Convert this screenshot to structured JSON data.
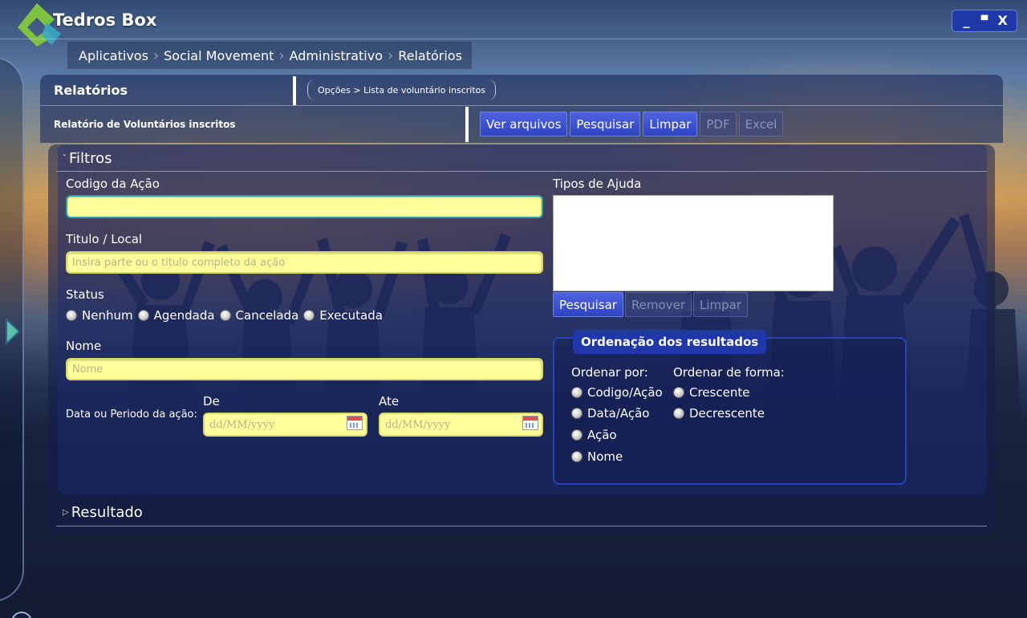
{
  "app": {
    "title": "Tedros Box"
  },
  "window_controls": {
    "minimize": "_",
    "maximize": "▀",
    "close": "X"
  },
  "breadcrumb": [
    "Aplicativos",
    "Social Movement",
    "Administrativo",
    "Relatórios"
  ],
  "header": {
    "title": "Relatórios",
    "path": "Opções > Lista de voluntário inscritos",
    "subtitle": "Relatório de Voluntários inscritos"
  },
  "toolbar": {
    "buttons": [
      {
        "label": "Ver arquivos",
        "enabled": true
      },
      {
        "label": "Pesquisar",
        "enabled": true
      },
      {
        "label": "Limpar",
        "enabled": true
      },
      {
        "label": "PDF",
        "enabled": false
      },
      {
        "label": "Excel",
        "enabled": false
      }
    ]
  },
  "filtros": {
    "title": "Filtros",
    "codigo_label": "Codigo da Ação",
    "codigo_value": "",
    "titulo_label": "Titulo / Local",
    "titulo_placeholder": "Insira parte ou o titulo completo da ação",
    "status_label": "Status",
    "status_options": [
      "Nenhum",
      "Agendada",
      "Cancelada",
      "Executada"
    ],
    "nome_label": "Nome",
    "nome_placeholder": "Nome",
    "data_label": "Data ou Periodo da ação:",
    "de_label": "De",
    "ate_label": "Ate",
    "date_placeholder": "dd/MM/yyyy",
    "tipos_label": "Tipos de Ajuda",
    "tipos_buttons": [
      {
        "label": "Pesquisar",
        "enabled": true
      },
      {
        "label": "Remover",
        "enabled": false
      },
      {
        "label": "Limpar",
        "enabled": false
      }
    ],
    "ordenacao": {
      "title": "Ordenação dos resultados",
      "ordenar_por_label": "Ordenar por:",
      "ordenar_por_options": [
        "Codigo/Ação",
        "Data/Ação",
        "Ação",
        "Nome"
      ],
      "ordenar_forma_label": "Ordenar de forma:",
      "ordenar_forma_options": [
        "Crescente",
        "Decrescente"
      ]
    }
  },
  "resultado": {
    "title": "Resultado"
  },
  "colors": {
    "accent": "#2f44c0",
    "input_bg": "#ffff9c",
    "focus_border": "#2aa3a8"
  }
}
